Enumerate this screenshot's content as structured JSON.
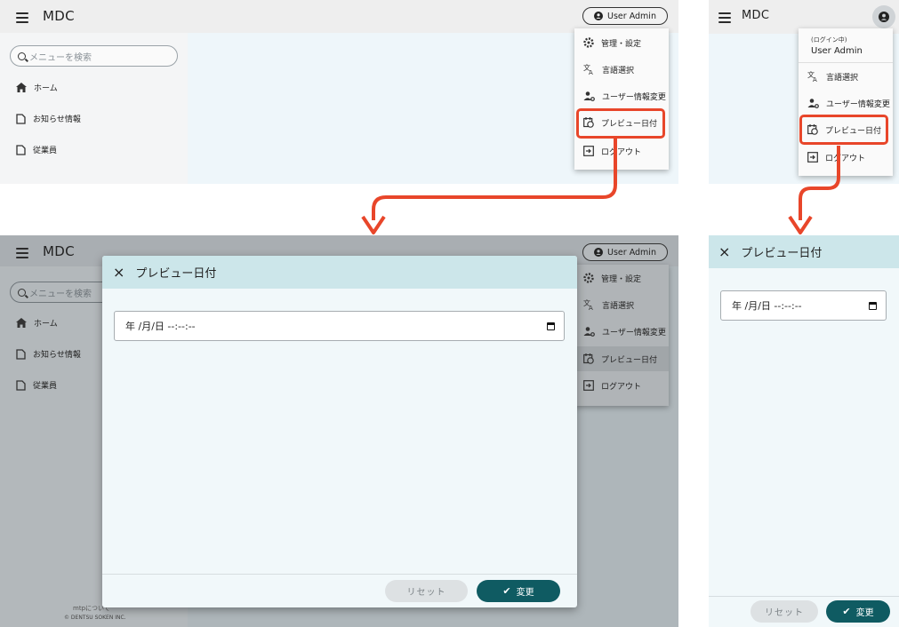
{
  "app": {
    "title": "MDC"
  },
  "search": {
    "placeholder": "メニューを検索"
  },
  "nav": {
    "items": [
      {
        "label": "ホーム"
      },
      {
        "label": "お知らせ情報"
      },
      {
        "label": "従業員"
      }
    ]
  },
  "user": {
    "name": "User Admin",
    "status_label": "(ログイン中)"
  },
  "user_menu": {
    "items": [
      {
        "label": "管理・設定",
        "icon": "gear-icon"
      },
      {
        "label": "言語選択",
        "icon": "translate-icon"
      },
      {
        "label": "ユーザー情報変更",
        "icon": "user-settings-icon"
      },
      {
        "label": "プレビュー日付",
        "icon": "calendar-clock-icon"
      },
      {
        "label": "ログアウト",
        "icon": "logout-icon"
      }
    ],
    "mobile_items": [
      {
        "label": "言語選択"
      },
      {
        "label": "ユーザー情報変更"
      },
      {
        "label": "プレビュー日付"
      },
      {
        "label": "ログアウト"
      }
    ]
  },
  "dialog": {
    "title": "プレビュー日付",
    "close_symbol": "×",
    "datetime_value": "年 /月/日 --:--:--",
    "reset_label": "リセット",
    "change_label": "変更"
  },
  "footer": {
    "about": "mtpについて",
    "copyright": "© DENTSU SOKEN INC."
  },
  "colors": {
    "accent": "#0f5b62",
    "highlight": "#e8462a",
    "dialog_header": "#cce6ea"
  }
}
